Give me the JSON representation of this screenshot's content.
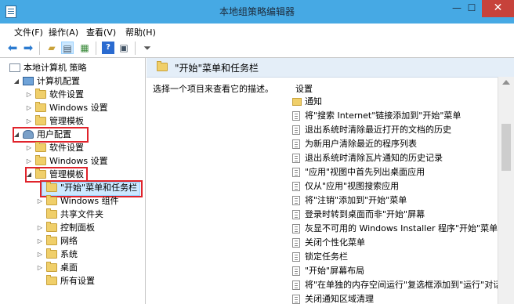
{
  "window": {
    "title": "本地组策略编辑器",
    "min": "—",
    "max": "☐",
    "close": "✕"
  },
  "menu": [
    "文件(F)",
    "操作(A)",
    "查看(V)",
    "帮助(H)"
  ],
  "toolbar_icons": [
    "back-arrow-icon",
    "forward-arrow-icon",
    "folder-up-icon",
    "show-hide-tree-icon",
    "export-list-icon",
    "help-icon",
    "properties-icon",
    "filter-icon"
  ],
  "tree": {
    "root": "本地计算机 策略",
    "computer_config": "计算机配置",
    "cc_software": "软件设置",
    "cc_windows": "Windows 设置",
    "cc_admin": "管理模板",
    "user_config": "用户配置",
    "uc_software": "软件设置",
    "uc_windows": "Windows 设置",
    "uc_admin": "管理模板",
    "start_menu": "\"开始\"菜单和任务栏",
    "windows_components": "Windows 组件",
    "shared_folders": "共享文件夹",
    "control_panel": "控制面板",
    "network": "网络",
    "system": "系统",
    "desktop": "桌面",
    "all_settings": "所有设置"
  },
  "right": {
    "header": "\"开始\"菜单和任务栏",
    "description": "选择一个项目来查看它的描述。",
    "list_header": "设置",
    "items": [
      {
        "type": "folder",
        "label": "通知"
      },
      {
        "type": "policy",
        "label": "将\"搜索 Internet\"链接添加到\"开始\"菜单"
      },
      {
        "type": "policy",
        "label": "退出系统时清除最近打开的文档的历史"
      },
      {
        "type": "policy",
        "label": "为新用户清除最近的程序列表"
      },
      {
        "type": "policy",
        "label": "退出系统时清除瓦片通知的历史记录"
      },
      {
        "type": "policy",
        "label": "\"应用\"视图中首先列出桌面应用"
      },
      {
        "type": "policy",
        "label": "仅从\"应用\"视图搜索应用"
      },
      {
        "type": "policy",
        "label": "将\"注销\"添加到\"开始\"菜单"
      },
      {
        "type": "policy",
        "label": "登录时转到桌面而非\"开始\"屏幕"
      },
      {
        "type": "policy",
        "label": "灰显不可用的 Windows Installer 程序\"开始\"菜单快捷"
      },
      {
        "type": "policy",
        "label": "关闭个性化菜单"
      },
      {
        "type": "policy",
        "label": "锁定任务栏"
      },
      {
        "type": "policy",
        "label": "\"开始\"屏幕布局"
      },
      {
        "type": "policy",
        "label": "将\"在单独的内存空间运行\"复选框添加到\"运行\"对话框"
      },
      {
        "type": "policy",
        "label": "关闭通知区域清理"
      }
    ]
  },
  "colors": {
    "titlebar": "#46a9e4",
    "close": "#c7423b",
    "highlight_box": "#e0232b",
    "selection": "#cce8ff",
    "header_bg": "#e4eef8"
  }
}
